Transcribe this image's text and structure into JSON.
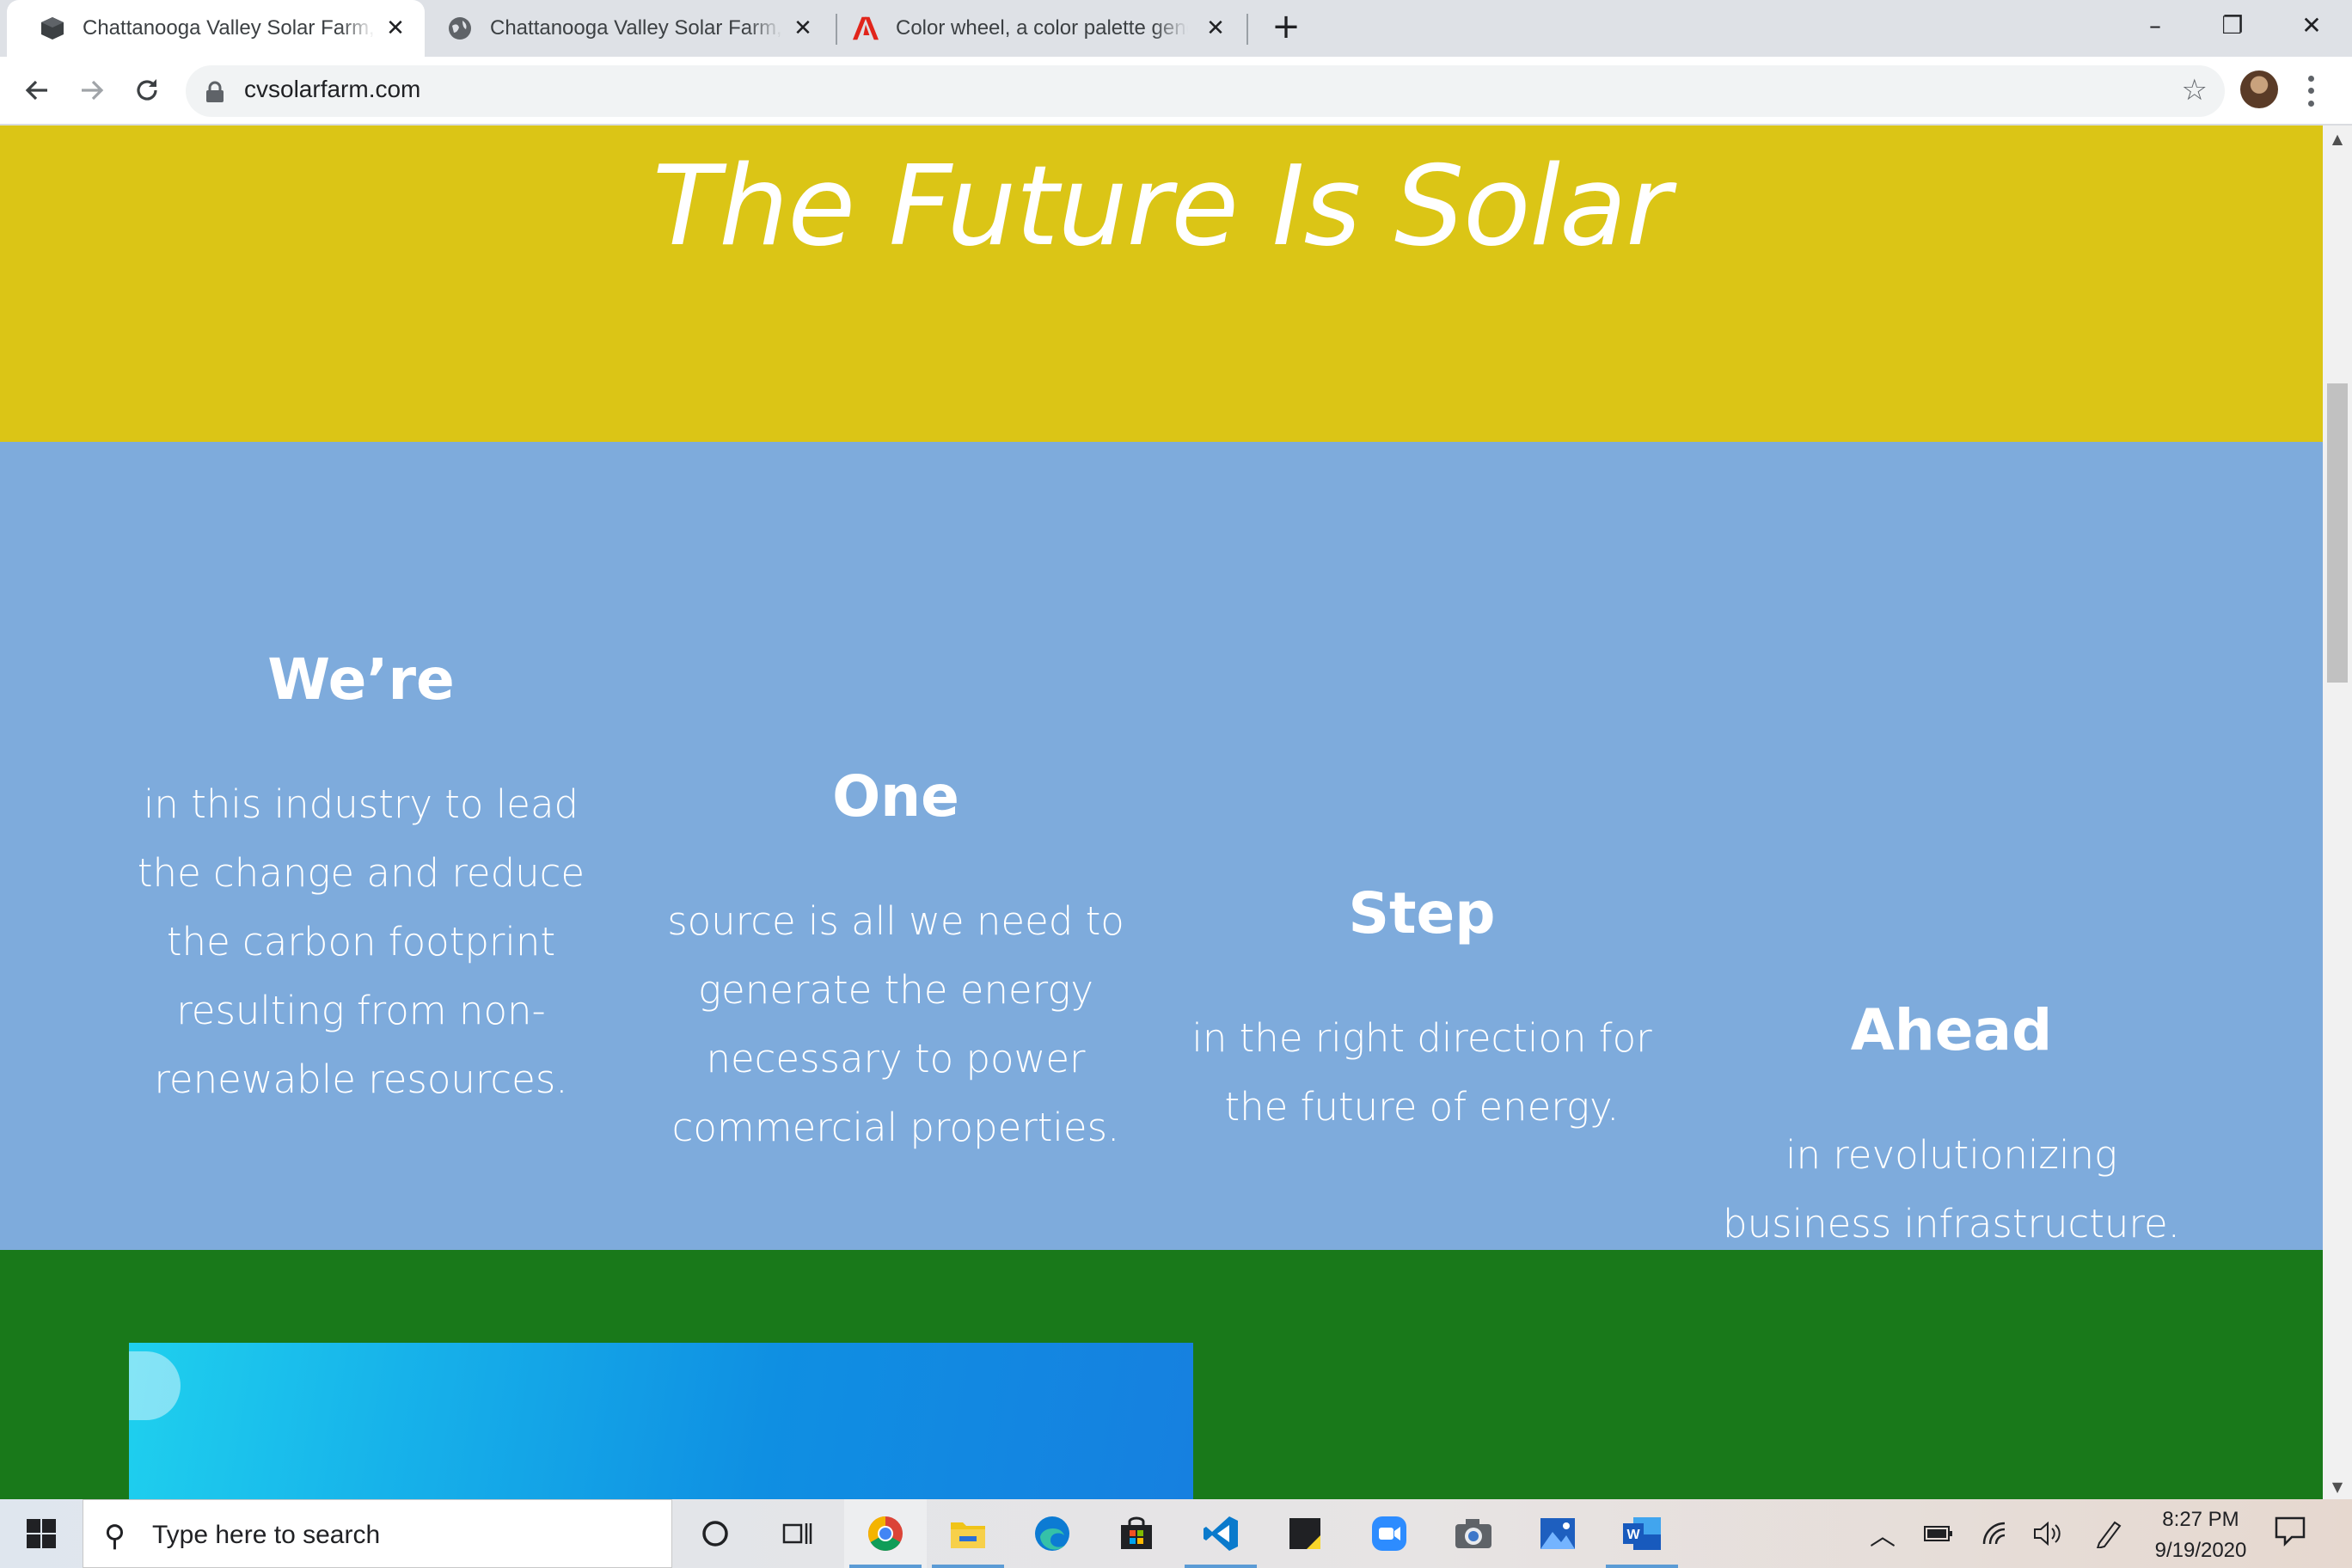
{
  "browser": {
    "tabs": [
      {
        "title": "Chattanooga Valley Solar Farm, LLC",
        "favicon": "cube-icon",
        "active": true
      },
      {
        "title": "Chattanooga Valley Solar Farm, LLC",
        "favicon": "globe-icon",
        "active": false
      },
      {
        "title": "Color wheel, a color palette generator",
        "favicon": "adobe-icon",
        "active": false
      }
    ],
    "url": "cvsolarfarm.com",
    "new_tab_label": "+",
    "window_controls": {
      "minimize": "–",
      "restore": "❐",
      "close": "✕"
    }
  },
  "page": {
    "hero_title": "The Future Is Solar",
    "columns": [
      {
        "heading": "We’re",
        "lines": [
          "in this industry to lead",
          "the change and reduce",
          "the carbon footprint",
          "resulting from non-",
          "renewable resources."
        ]
      },
      {
        "heading": "One",
        "lines": [
          "source is all we need to",
          "generate the energy",
          "necessary to power",
          "commercial properties."
        ]
      },
      {
        "heading": "Step",
        "lines": [
          "in the right direction for",
          "the future of energy."
        ]
      },
      {
        "heading": "Ahead",
        "lines": [
          "in revolutionizing",
          "business infrastructure."
        ]
      }
    ]
  },
  "taskbar": {
    "search_placeholder": "Type here to search",
    "time": "8:27 PM",
    "date": "9/19/2020",
    "apps": [
      "cortana-icon",
      "task-view-icon",
      "chrome-icon",
      "file-explorer-icon",
      "edge-icon",
      "store-icon",
      "vscode-icon",
      "sticky-notes-icon",
      "zoom-icon",
      "camera-icon",
      "photos-icon",
      "word-icon"
    ]
  },
  "colors": {
    "yellow_band": "#dbc516",
    "blue_band": "#7eabdc",
    "green_band": "#19791a",
    "text_on_bands": "#ffffff"
  }
}
